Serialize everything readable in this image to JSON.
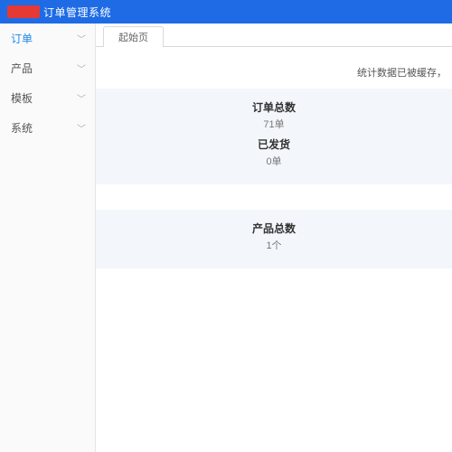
{
  "header": {
    "title": "订单管理系统"
  },
  "sidebar": {
    "items": [
      {
        "label": "订单",
        "active": true
      },
      {
        "label": "产品",
        "active": false
      },
      {
        "label": "模板",
        "active": false
      },
      {
        "label": "系统",
        "active": false
      }
    ]
  },
  "tabs": [
    {
      "label": "起始页"
    }
  ],
  "notice": "统计数据已被缓存，",
  "stats": [
    {
      "rows": [
        {
          "label": "订单总数",
          "value": "71单"
        },
        {
          "label": "已发货",
          "value": "0单"
        }
      ]
    },
    {
      "rows": [
        {
          "label": "产品总数",
          "value": "1个"
        }
      ]
    }
  ]
}
